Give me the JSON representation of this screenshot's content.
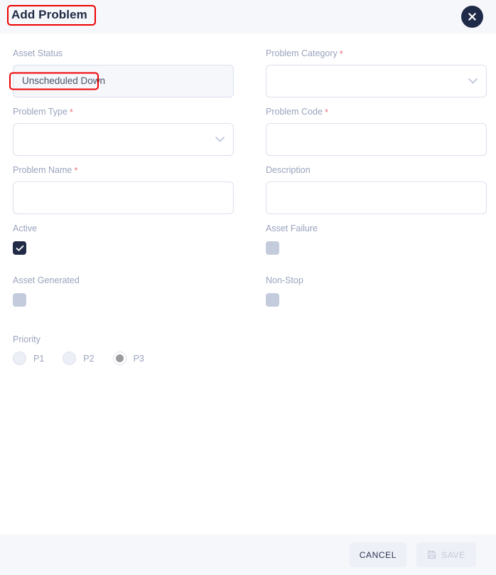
{
  "header": {
    "title": "Add Problem",
    "close_icon": "close-x-icon",
    "annotation": "red-highlight-box"
  },
  "form": {
    "asset_status": {
      "label": "Asset Status",
      "value": "Unscheduled Down",
      "required": false,
      "readonly": true,
      "annotation": "red-highlight-box"
    },
    "problem_category": {
      "label": "Problem Category",
      "value": "",
      "required": true,
      "type": "select",
      "icon": "chevron-down-icon"
    },
    "problem_type": {
      "label": "Problem Type",
      "value": "",
      "required": true,
      "type": "select",
      "icon": "chevron-down-icon"
    },
    "problem_code": {
      "label": "Problem Code",
      "value": "",
      "required": true,
      "type": "text"
    },
    "problem_name": {
      "label": "Problem Name",
      "value": "",
      "required": true,
      "type": "text"
    },
    "description": {
      "label": "Description",
      "value": "",
      "required": false,
      "type": "text"
    },
    "active": {
      "label": "Active",
      "checked": true,
      "icon": "checkmark-icon"
    },
    "asset_failure": {
      "label": "Asset Failure",
      "checked": false
    },
    "asset_generated": {
      "label": "Asset Generated",
      "checked": false
    },
    "non_stop": {
      "label": "Non-Stop",
      "checked": false
    },
    "priority": {
      "label": "Priority",
      "selected": "P3",
      "options": [
        {
          "label": "P1",
          "selected": false
        },
        {
          "label": "P2",
          "selected": false
        },
        {
          "label": "P3",
          "selected": true
        }
      ]
    }
  },
  "footer": {
    "cancel_label": "CANCEL",
    "save_label": "SAVE",
    "save_icon": "floppy-disk-save-icon",
    "save_disabled": true
  },
  "colors": {
    "header_bg": "#f6f7fb",
    "title": "#1f2a44",
    "label": "#9aa3bd",
    "required_star": "#e8707f",
    "border": "#dbe0ec",
    "checkbox_on": "#222b45",
    "checkbox_off": "#c3cbdd",
    "close_bg": "#1e2a47",
    "annotation": "#ee0000"
  }
}
